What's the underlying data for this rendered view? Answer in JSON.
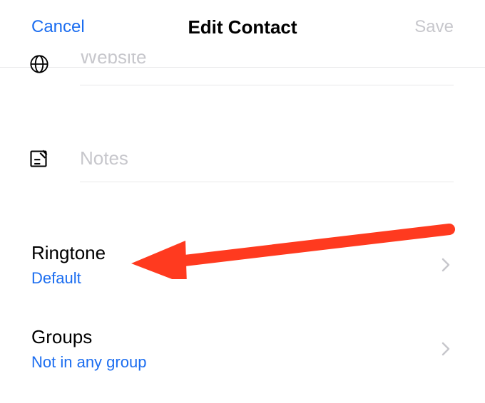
{
  "header": {
    "cancel_label": "Cancel",
    "title": "Edit Contact",
    "save_label": "Save"
  },
  "fields": {
    "website_placeholder": "Website",
    "notes_placeholder": "Notes"
  },
  "ringtone": {
    "label": "Ringtone",
    "value": "Default"
  },
  "groups": {
    "label": "Groups",
    "value": "Not in any group"
  },
  "annotation": {
    "target": "ringtone-row",
    "color": "#ff3a1f"
  }
}
